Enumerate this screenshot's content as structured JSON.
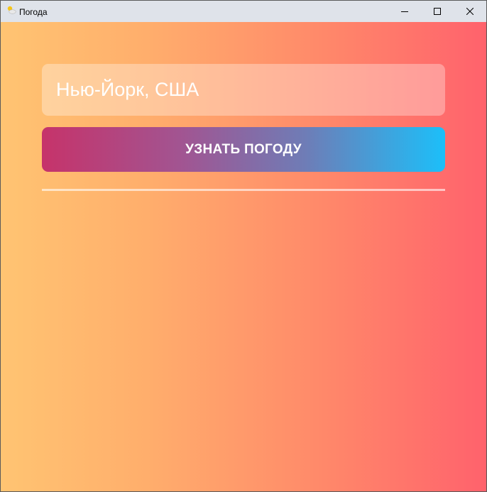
{
  "window": {
    "title": "Погода",
    "icon": "sun-cloud-icon"
  },
  "controls": {
    "minimize_icon": "minimize-icon",
    "maximize_icon": "maximize-icon",
    "close_icon": "close-icon"
  },
  "form": {
    "city_value": "Нью-Йорк, США",
    "button_label": "УЗНАТЬ ПОГОДУ"
  },
  "colors": {
    "background_gradient": [
      "#ffc472",
      "#ff626c"
    ],
    "button_gradient": [
      "#c6336a",
      "#1cbff9"
    ],
    "titlebar": "#dfe3ea"
  }
}
